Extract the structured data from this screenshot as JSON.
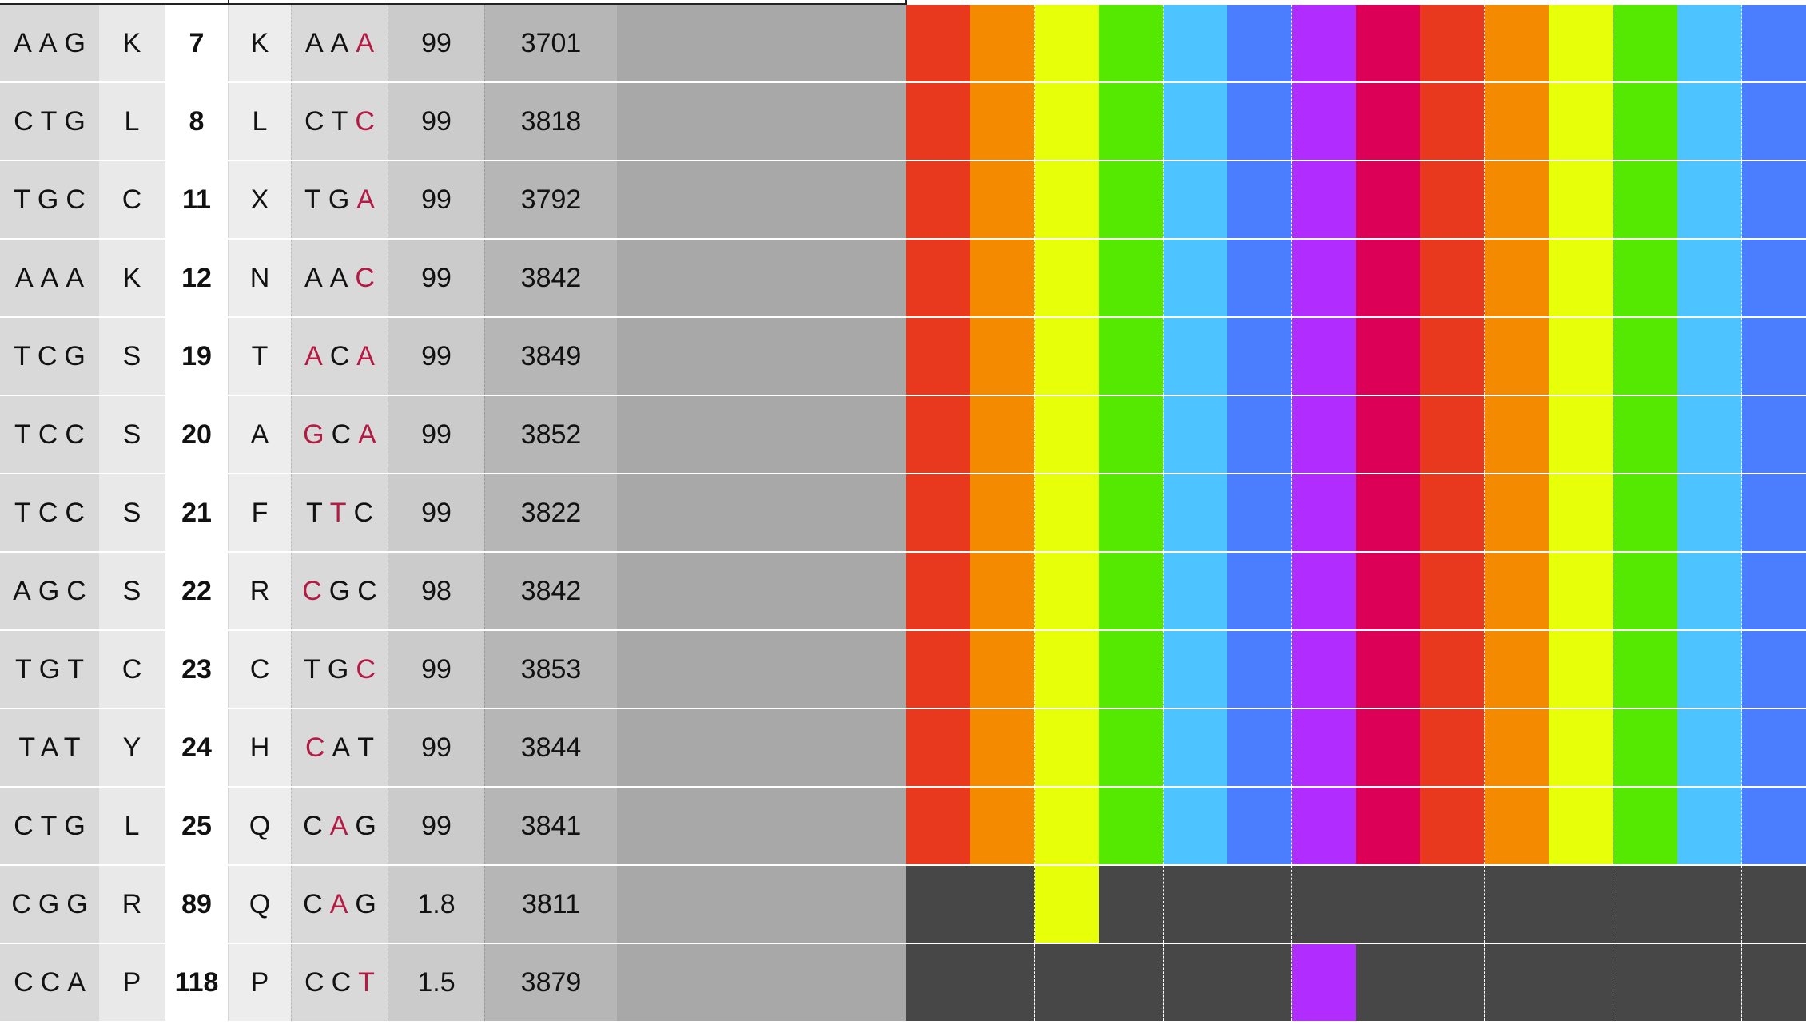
{
  "palette": {
    "red": "#e8391e",
    "orange": "#f38a00",
    "yellow": "#e8ff0a",
    "green": "#55e800",
    "skyblue": "#4dc3ff",
    "blue": "#4a7dff",
    "purple": "#b02cff",
    "crimson": "#dc0057",
    "dark": "#474747"
  },
  "swatch_columns": [
    "red",
    "orange",
    "yellow",
    "green",
    "skyblue",
    "blue",
    "purple",
    "crimson",
    "red",
    "orange",
    "yellow",
    "green",
    "skyblue",
    "blue"
  ],
  "rows": [
    {
      "wt_codon": "AAG",
      "wt_aa": "K",
      "position": "7",
      "mt_aa": "K",
      "mt_codon": [
        "A",
        "A",
        "A"
      ],
      "mutated": [
        false,
        false,
        true
      ],
      "quality": "99",
      "coverage": "3701",
      "swatch_mode": "full",
      "active": []
    },
    {
      "wt_codon": "CTG",
      "wt_aa": "L",
      "position": "8",
      "mt_aa": "L",
      "mt_codon": [
        "C",
        "T",
        "C"
      ],
      "mutated": [
        false,
        false,
        true
      ],
      "quality": "99",
      "coverage": "3818",
      "swatch_mode": "full",
      "active": []
    },
    {
      "wt_codon": "TGC",
      "wt_aa": "C",
      "position": "11",
      "mt_aa": "X",
      "mt_codon": [
        "T",
        "G",
        "A"
      ],
      "mutated": [
        false,
        false,
        true
      ],
      "quality": "99",
      "coverage": "3792",
      "swatch_mode": "full",
      "active": []
    },
    {
      "wt_codon": "AAA",
      "wt_aa": "K",
      "position": "12",
      "mt_aa": "N",
      "mt_codon": [
        "A",
        "A",
        "C"
      ],
      "mutated": [
        false,
        false,
        true
      ],
      "quality": "99",
      "coverage": "3842",
      "swatch_mode": "full",
      "active": []
    },
    {
      "wt_codon": "TCG",
      "wt_aa": "S",
      "position": "19",
      "mt_aa": "T",
      "mt_codon": [
        "A",
        "C",
        "A"
      ],
      "mutated": [
        true,
        false,
        true
      ],
      "quality": "99",
      "coverage": "3849",
      "swatch_mode": "full",
      "active": []
    },
    {
      "wt_codon": "TCC",
      "wt_aa": "S",
      "position": "20",
      "mt_aa": "A",
      "mt_codon": [
        "G",
        "C",
        "A"
      ],
      "mutated": [
        true,
        false,
        true
      ],
      "quality": "99",
      "coverage": "3852",
      "swatch_mode": "full",
      "active": []
    },
    {
      "wt_codon": "TCC",
      "wt_aa": "S",
      "position": "21",
      "mt_aa": "F",
      "mt_codon": [
        "T",
        "T",
        "C"
      ],
      "mutated": [
        false,
        true,
        false
      ],
      "quality": "99",
      "coverage": "3822",
      "swatch_mode": "full",
      "active": []
    },
    {
      "wt_codon": "AGC",
      "wt_aa": "S",
      "position": "22",
      "mt_aa": "R",
      "mt_codon": [
        "C",
        "G",
        "C"
      ],
      "mutated": [
        true,
        false,
        false
      ],
      "quality": "98",
      "coverage": "3842",
      "swatch_mode": "full",
      "active": []
    },
    {
      "wt_codon": "TGT",
      "wt_aa": "C",
      "position": "23",
      "mt_aa": "C",
      "mt_codon": [
        "T",
        "G",
        "C"
      ],
      "mutated": [
        false,
        false,
        true
      ],
      "quality": "99",
      "coverage": "3853",
      "swatch_mode": "full",
      "active": []
    },
    {
      "wt_codon": "TAT",
      "wt_aa": "Y",
      "position": "24",
      "mt_aa": "H",
      "mt_codon": [
        "C",
        "A",
        "T"
      ],
      "mutated": [
        true,
        false,
        false
      ],
      "quality": "99",
      "coverage": "3844",
      "swatch_mode": "full",
      "active": []
    },
    {
      "wt_codon": "CTG",
      "wt_aa": "L",
      "position": "25",
      "mt_aa": "Q",
      "mt_codon": [
        "C",
        "A",
        "G"
      ],
      "mutated": [
        false,
        true,
        false
      ],
      "quality": "99",
      "coverage": "3841",
      "swatch_mode": "full",
      "active": []
    },
    {
      "wt_codon": "CGG",
      "wt_aa": "R",
      "position": "89",
      "mt_aa": "Q",
      "mt_codon": [
        "C",
        "A",
        "G"
      ],
      "mutated": [
        false,
        true,
        false
      ],
      "quality": "1.8",
      "coverage": "3811",
      "swatch_mode": "sparse",
      "active": [
        2
      ]
    },
    {
      "wt_codon": "CCA",
      "wt_aa": "P",
      "position": "118",
      "mt_aa": "P",
      "mt_codon": [
        "C",
        "C",
        "T"
      ],
      "mutated": [
        false,
        false,
        true
      ],
      "quality": "1.5",
      "coverage": "3879",
      "swatch_mode": "sparse",
      "active": [
        6
      ]
    }
  ]
}
